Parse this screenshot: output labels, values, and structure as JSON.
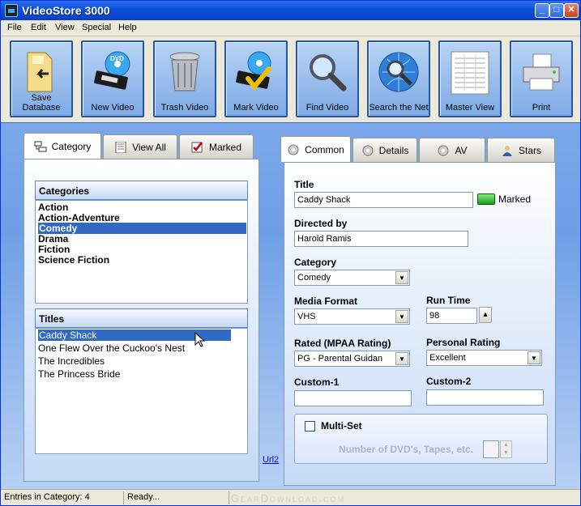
{
  "window": {
    "title": "VideoStore 3000",
    "buttons": {
      "minimize": "_",
      "maximize": "□",
      "close": "✕"
    }
  },
  "menu": [
    "File",
    "Edit",
    "View",
    "Special",
    "Help"
  ],
  "toolbar": [
    {
      "label": "Save Database",
      "icon": "folder-save-icon"
    },
    {
      "label": "New Video",
      "icon": "dvd-tape-icon"
    },
    {
      "label": "Trash Video",
      "icon": "trash-can-icon"
    },
    {
      "label": "Mark Video",
      "icon": "dvd-checkmark-icon"
    },
    {
      "label": "Find Video",
      "icon": "magnifier-icon"
    },
    {
      "label": "Search the Net",
      "icon": "globe-magnifier-icon"
    },
    {
      "label": "Master View",
      "icon": "spreadsheet-icon"
    },
    {
      "label": "Print",
      "icon": "printer-icon"
    }
  ],
  "left_tabs": [
    {
      "label": "Category",
      "icon": "category-tree-icon"
    },
    {
      "label": "View All",
      "icon": "document-list-icon"
    },
    {
      "label": "Marked",
      "icon": "checkbox-checked-icon"
    }
  ],
  "categories_header": "Categories",
  "categories": [
    "Action",
    "Action-Adventure",
    "Comedy",
    "Drama",
    "Fiction",
    "Science Fiction"
  ],
  "titles_header": "Titles",
  "titles": [
    "Caddy Shack",
    "One Flew Over the Cuckoo's Nest",
    "The Incredibles",
    "The Princess Bride"
  ],
  "url_link": "Url2",
  "right_tabs": [
    {
      "label": "Common",
      "icon": "cd-icon"
    },
    {
      "label": "Details",
      "icon": "cd-icon"
    },
    {
      "label": "AV",
      "icon": "cd-icon"
    },
    {
      "label": "Stars",
      "icon": "person-icon"
    }
  ],
  "form": {
    "title_label": "Title",
    "title_value": "Caddy Shack",
    "marked_label": "Marked",
    "director_label": "Directed by",
    "director_value": "Harold Ramis",
    "category_label": "Category",
    "category_value": "Comedy",
    "format_label": "Media Format",
    "format_value": "VHS",
    "runtime_label": "Run Time",
    "runtime_value": "98",
    "rated_label": "Rated (MPAA Rating)",
    "rated_value": "PG - Parental Guidan",
    "personal_label": "Personal Rating",
    "personal_value": "Excellent",
    "custom1_label": "Custom-1",
    "custom1_value": "",
    "custom2_label": "Custom-2",
    "custom2_value": "",
    "multiset_label": "Multi-Set",
    "dvds_label": "Number of DVD's, Tapes, etc.",
    "dvds_value": ""
  },
  "status": {
    "entries": "Entries in Category: 4",
    "ready": "Ready...",
    "watermark": "GearDownload.com"
  }
}
